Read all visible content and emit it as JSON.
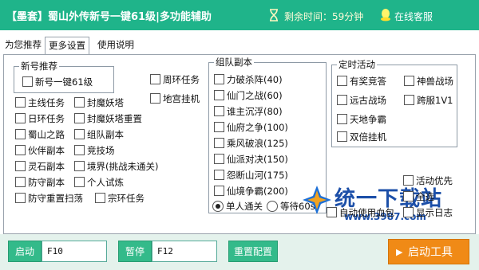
{
  "titlebar": {
    "title": "【墨套】蜀山外传新号一键61级|多功能辅助",
    "timer_text": "剩余时间：59分钟",
    "service_text": "在线客服"
  },
  "tabs": [
    "为您推荐",
    "更多设置",
    "使用说明"
  ],
  "active_tab": "更多设置",
  "groups": {
    "new_account": "新号推荐",
    "team": "组队副本",
    "timed": "定时活动"
  },
  "checkboxes": {
    "new_61": "新号一键61级",
    "zhouhuan": "周环任务",
    "digong": "地宫挂机",
    "zhuxian": "主线任务",
    "fengmo_ta": "封魔妖塔",
    "richang": "日环任务",
    "fengmo_chongzhi": "封魔妖塔重置",
    "shushan": "蜀山之路",
    "zudui_fuben": "组队副本",
    "huoban": "伙伴副本",
    "jingji": "竞技场",
    "lingshi": "灵石副本",
    "jingjie": "境界(挑战未通关)",
    "fangshou": "防守副本",
    "geren": "个人试炼",
    "fangshou_chongzhi": "防守重置扫荡",
    "zonghuan": "宗环任务",
    "lipo": "力破杀阵(40)",
    "xianmen": "仙门之战(60)",
    "shuizhu": "谁主沉浮(80)",
    "xianfu": "仙府之争(100)",
    "chengfeng": "乘风破浪(125)",
    "xianpai": "仙派对决(150)",
    "yuanduan": "怨断山河(175)",
    "xianjing": "仙境争霸(200)",
    "youjiang": "有奖竞答",
    "shenshou": "神兽战场",
    "yuangu": "远古战场",
    "kuafu": "跨服1V1",
    "tiandi": "天地争霸",
    "shuangbei": "双倍挂机",
    "huodong_youxian": "活动优先",
    "quanxuan": "全选",
    "zidong_xuebao": "自动使用血包",
    "xianshi_rizhi": "显示日志"
  },
  "radios": {
    "single": "单人通关",
    "wait": "等待60s"
  },
  "bottom": {
    "start_label": "启动",
    "start_key": "F10",
    "pause_label": "暂停",
    "pause_key": "F12",
    "reset_label": "重置配置",
    "launch_label": "启动工具"
  },
  "watermark": {
    "text": "统一下载站",
    "url": "www.3987.com"
  },
  "colors": {
    "titlebar": "#1fb48a",
    "button_green": "#33ba8a",
    "button_orange": "#f08a16"
  }
}
